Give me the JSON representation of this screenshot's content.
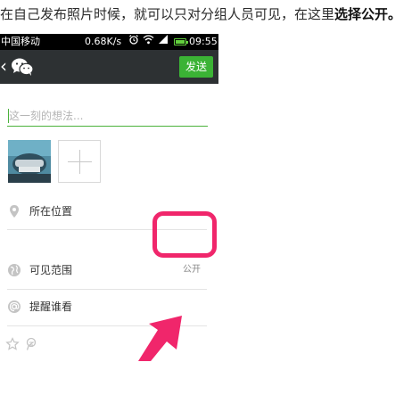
{
  "caption": {
    "text": "在自己发布照片时候，就可以只对分组人员可见，在这里",
    "bold": "选择公开。"
  },
  "statusbar": {
    "carrier": "中国移动",
    "speed": "0.68K/s",
    "time": "09:55",
    "battery_color": "#63d03e"
  },
  "navbar": {
    "back_icon": "chevron-left-icon",
    "logo_icon": "wechat-icon",
    "send_label": "发送",
    "background": "#2d3133",
    "send_color": "#3bb335"
  },
  "compose": {
    "placeholder": "这一刻的想法..."
  },
  "rows": {
    "location": {
      "label": "所在位置",
      "icon": "location-pin-icon"
    },
    "visibility": {
      "label": "可见范围",
      "value": "公开",
      "icon": "globe-icon"
    },
    "remind": {
      "label": "提醒谁看",
      "icon": "at-icon"
    }
  },
  "bottom": {
    "icons": [
      "star-icon",
      "qzone-icon"
    ]
  },
  "annotation": {
    "highlight_color": "#f0266b"
  }
}
